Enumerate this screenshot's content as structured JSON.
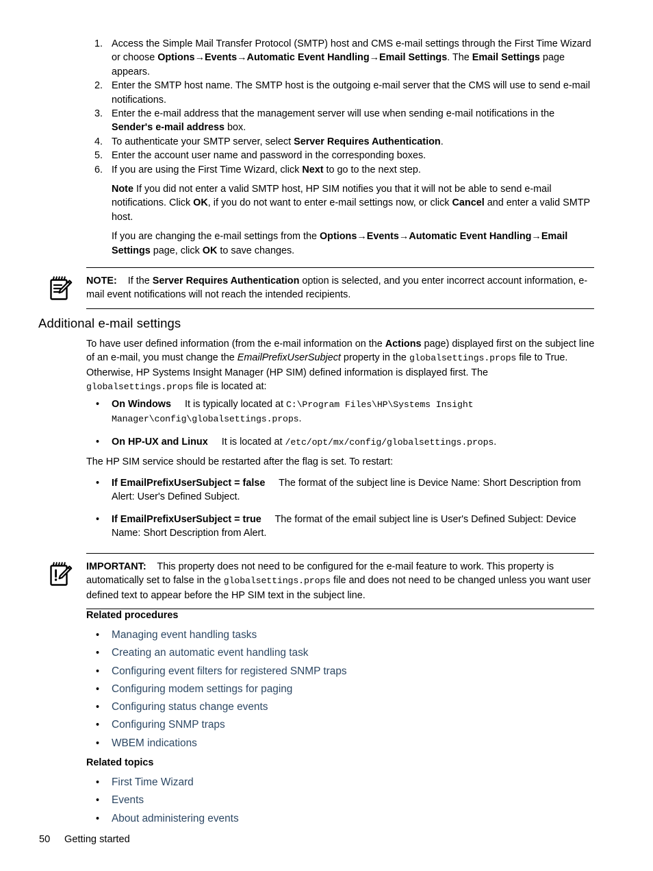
{
  "colors": {
    "link": "#2c4763",
    "text": "#000000",
    "rule": "#000000",
    "background": "#ffffff"
  },
  "procedure": {
    "items": [
      {
        "number": "1.",
        "parts": [
          {
            "t": "Access the Simple Mail Transfer Protocol (SMTP) host and CMS e-mail settings through the First Time Wizard or choose ",
            "s": "n"
          },
          {
            "t": "Options",
            "s": "b"
          },
          {
            "t": "→",
            "s": "b"
          },
          {
            "t": "Events",
            "s": "b"
          },
          {
            "t": "→",
            "s": "b"
          },
          {
            "t": "Automatic Event Handling",
            "s": "b"
          },
          {
            "t": "→",
            "s": "b"
          },
          {
            "t": "Email Settings",
            "s": "b"
          },
          {
            "t": ". The ",
            "s": "n"
          },
          {
            "t": "Email Settings",
            "s": "b"
          },
          {
            "t": " page appears.",
            "s": "n"
          }
        ]
      },
      {
        "number": "2.",
        "parts": [
          {
            "t": "Enter the SMTP host name. The SMTP host is the outgoing e-mail server that the CMS will use to send e-mail notifications.",
            "s": "n"
          }
        ]
      },
      {
        "number": "3.",
        "parts": [
          {
            "t": "Enter the e-mail address that the management server will use when sending e-mail notifications in the ",
            "s": "n"
          },
          {
            "t": "Sender's e-mail address",
            "s": "b"
          },
          {
            "t": " box.",
            "s": "n"
          }
        ]
      },
      {
        "number": "4.",
        "parts": [
          {
            "t": "To authenticate your SMTP server, select ",
            "s": "n"
          },
          {
            "t": "Server Requires Authentication",
            "s": "b"
          },
          {
            "t": ".",
            "s": "n"
          }
        ]
      },
      {
        "number": "5.",
        "parts": [
          {
            "t": "Enter the account user name and password in the corresponding boxes.",
            "s": "n"
          }
        ]
      },
      {
        "number": "6.",
        "parts": [
          {
            "t": "If you are using the First Time Wizard, click ",
            "s": "n"
          },
          {
            "t": "Next",
            "s": "b"
          },
          {
            "t": " to go to the next step.",
            "s": "n"
          }
        ]
      }
    ],
    "note_paragraph": [
      {
        "t": "Note",
        "s": "b"
      },
      {
        "t": " If you did not enter a valid SMTP host, HP SIM notifies you that it will not be able to send e-mail notifications. Click ",
        "s": "n"
      },
      {
        "t": "OK",
        "s": "b"
      },
      {
        "t": ", if you do not want to enter e-mail settings now, or click ",
        "s": "n"
      },
      {
        "t": "Cancel",
        "s": "b"
      },
      {
        "t": " and enter a valid SMTP host.",
        "s": "n"
      }
    ],
    "changing_paragraph": [
      {
        "t": "If you are changing the e-mail settings from the ",
        "s": "n"
      },
      {
        "t": "Options",
        "s": "b"
      },
      {
        "t": "→",
        "s": "b"
      },
      {
        "t": "Events",
        "s": "b"
      },
      {
        "t": "→",
        "s": "b"
      },
      {
        "t": "Automatic Event Handling",
        "s": "b"
      },
      {
        "t": "→",
        "s": "b"
      },
      {
        "t": "Email Settings",
        "s": "b"
      },
      {
        "t": " page, click ",
        "s": "n"
      },
      {
        "t": "OK",
        "s": "b"
      },
      {
        "t": " to save changes.",
        "s": "n"
      }
    ]
  },
  "note_admonition": {
    "icon": "note-pad-pencil-icon",
    "parts": [
      {
        "t": "NOTE:",
        "s": "b"
      },
      {
        "t": "    If the ",
        "s": "n"
      },
      {
        "t": "Server Requires Authentication",
        "s": "b"
      },
      {
        "t": " option is selected, and you enter incorrect account information, e-mail event notifications will not reach the intended recipients.",
        "s": "n"
      }
    ]
  },
  "section": {
    "heading": "Additional e-mail settings",
    "intro_parts": [
      {
        "t": "To have user defined information (from the e-mail information on the ",
        "s": "n"
      },
      {
        "t": "Actions",
        "s": "b"
      },
      {
        "t": " page) displayed first on the subject line of an e-mail, you must change the ",
        "s": "n"
      },
      {
        "t": "EmailPrefixUserSubject",
        "s": "i"
      },
      {
        "t": " property in the ",
        "s": "n"
      },
      {
        "t": "globalsettings.props",
        "s": "m"
      },
      {
        "t": " file to True. Otherwise, HP Systems Insight Manager (HP SIM) defined information is displayed first. The ",
        "s": "n"
      },
      {
        "t": "globalsettings.props",
        "s": "m"
      },
      {
        "t": " file is located at:",
        "s": "n"
      }
    ],
    "location_bullets": [
      {
        "bullet": "•",
        "parts": [
          {
            "t": "On Windows",
            "s": "b"
          },
          {
            "t": "     It is typically located at ",
            "s": "n"
          },
          {
            "t": "C:\\Program Files\\HP\\Systems Insight Manager\\config\\globalsettings.props",
            "s": "m"
          },
          {
            "t": ".",
            "s": "n"
          }
        ]
      },
      {
        "bullet": "•",
        "parts": [
          {
            "t": "On HP-UX and Linux",
            "s": "b"
          },
          {
            "t": "     It is located at ",
            "s": "n"
          },
          {
            "t": "/etc/opt/mx/config/globalsettings.props",
            "s": "m"
          },
          {
            "t": ".",
            "s": "n"
          }
        ]
      }
    ],
    "restart_paragraph": [
      {
        "t": "The HP SIM service should be restarted after the flag is set. To restart:",
        "s": "n"
      }
    ],
    "flag_bullets": [
      {
        "bullet": "•",
        "parts": [
          {
            "t": "If EmailPrefixUserSubject = false",
            "s": "b"
          },
          {
            "t": "     The format of the subject line is Device Name: Short Description from Alert: User's Defined Subject.",
            "s": "n"
          }
        ]
      },
      {
        "bullet": "•",
        "parts": [
          {
            "t": "If EmailPrefixUserSubject = true",
            "s": "b"
          },
          {
            "t": "     The format of the email subject line is User's Defined Subject: Device Name: Short Description from Alert.",
            "s": "n"
          }
        ]
      }
    ]
  },
  "important_admonition": {
    "icon": "important-pad-pencil-icon",
    "parts": [
      {
        "t": "IMPORTANT:",
        "s": "b"
      },
      {
        "t": "    This property does not need to be configured for the e-mail feature to work. This property is automatically set to false in the ",
        "s": "n"
      },
      {
        "t": "globalsettings.props",
        "s": "m"
      },
      {
        "t": " file and does not need to be changed unless you want user defined text to appear before the HP SIM text in the subject line.",
        "s": "n"
      }
    ]
  },
  "related_procedures": {
    "heading": "Related procedures",
    "bullet": "•",
    "links": [
      "Managing event handling tasks",
      "Creating an automatic event handling task",
      "Configuring event filters for registered SNMP traps",
      "Configuring modem settings for paging",
      "Configuring status change events",
      "Configuring SNMP traps",
      "WBEM indications"
    ]
  },
  "related_topics": {
    "heading": "Related topics",
    "bullet": "•",
    "links": [
      "First Time Wizard",
      "Events",
      "About administering events"
    ]
  },
  "footer": {
    "page_number": "50",
    "chapter": "Getting started"
  }
}
